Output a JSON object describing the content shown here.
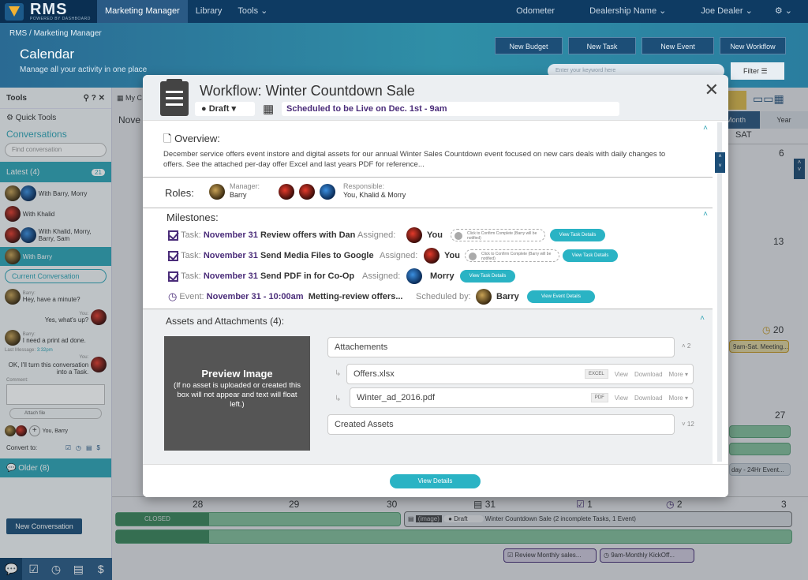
{
  "topbar": {
    "logo": "RMS",
    "logo_sub": "POWERED BY DASHBOARD",
    "tabs": [
      "Marketing Manager",
      "Library",
      "Tools"
    ],
    "odometer": "Odometer",
    "dealership": "Dealership Name",
    "user": "Joe Dealer"
  },
  "header": {
    "breadcrumb_root": "RMS",
    "breadcrumb_sep": "/",
    "breadcrumb_page": "Marketing Manager",
    "title": "Calendar",
    "subtitle": "Manage all your activity in one place",
    "buttons": [
      "New Budget",
      "New Task",
      "New Event",
      "New Workflow"
    ],
    "search_placeholder": "Enter your keyword here",
    "filter": "Filter"
  },
  "sidebar": {
    "tools": "Tools",
    "quick_tools": "Quick Tools",
    "conversations": "Conversations",
    "find_placeholder": "Find conversation",
    "latest": "Latest (4)",
    "latest_badge": "21",
    "threads": [
      "With Barry, Morry",
      "With Khalid",
      "With Khalid, Morry, Barry, Sam",
      "With Barry"
    ],
    "current_conv": "Current Conversation",
    "messages": [
      {
        "from": "Barry:",
        "text": "Hey, have a minute?"
      },
      {
        "from": "You:",
        "text": "Yes, what's up?"
      },
      {
        "from": "Barry:",
        "text": "I need a print ad done."
      },
      {
        "from": "You:",
        "text": "OK, I'll turn this conversation into a Task."
      }
    ],
    "last_message_label": "Last Message:",
    "last_message_time": "3:32pm",
    "comment_label": "Comment:",
    "attach": "Attach file",
    "participants": "You, Barry",
    "convert_to": "Convert to:",
    "older": "Older (8)",
    "new_conv": "New Conversation"
  },
  "calendar": {
    "toolbar_label": "My C",
    "month_label": "Nove",
    "views": [
      "Month",
      "Year"
    ],
    "sat": "SAT",
    "days": [
      "6",
      "13",
      "20",
      "27",
      "28",
      "29",
      "30",
      "31",
      "1",
      "2",
      "3"
    ],
    "events": {
      "e20": "9am-Sat. Meeting...",
      "e27": "day - 24Hr Event...",
      "closed": "CLOSED",
      "image": "(image)",
      "draft": "Draft",
      "workflow_bar": "Winter Countdown Sale (2 incomplete Tasks, 1 Event)",
      "review": "Review Monthly sales...",
      "kickoff": "9am-Monthly KickOff..."
    }
  },
  "modal": {
    "title": "Workflow: Winter Countdown Sale",
    "status": "Draft",
    "schedule_prefix": "Scheduled to be Live on",
    "schedule_date": "Dec. 1st - 9am",
    "overview_label": "Overview:",
    "overview_text": "December service offers event instore and digital assets for our annual Winter Sales Countdown event focused on new cars deals with daily changes to offers. See the attached per-day offer Excel and last years PDF for reference...",
    "roles_label": "Roles:",
    "manager_label": "Manager:",
    "manager_name": "Barry",
    "responsible_label": "Responsible:",
    "responsible_names": "You, Khalid & Morry",
    "milestones_label": "Milestones:",
    "milestones": [
      {
        "type": "Task:",
        "date": "November 31",
        "text": "Review offers with Dan",
        "assigned_label": "Assigned:",
        "assignee": "You",
        "confirm": "Click to Confirm Complete (Barry will be notified)",
        "button": "View Task Details"
      },
      {
        "type": "Task:",
        "date": "November 31",
        "text": "Send Media Files to Google",
        "assigned_label": "Assigned:",
        "assignee": "You",
        "confirm": "Click to Confirm Complete (Barry will be notified)",
        "button": "View Task Details"
      },
      {
        "type": "Task:",
        "date": "November 31",
        "text": "Send PDF in for Co-Op",
        "assigned_label": "Assigned:",
        "assignee": "Morry",
        "button": "View Task Details"
      },
      {
        "type": "Event:",
        "date": "November 31 - 10:00am",
        "text": "Metting-review offers...",
        "assigned_label": "Scheduled by:",
        "assignee": "Barry",
        "button": "View Event Details"
      }
    ],
    "assets_label": "Assets and Attachments (4):",
    "preview_title": "Preview Image",
    "preview_text": "(If no asset is uploaded or created this box will not appear and text will float left.)",
    "attachments_label": "Attachements",
    "attachments_count": "2",
    "files": [
      {
        "name": "Offers.xlsx",
        "tag": "EXCEL"
      },
      {
        "name": "Winter_ad_2016.pdf",
        "tag": "PDF"
      }
    ],
    "file_view": "View",
    "file_download": "Download",
    "file_more": "More",
    "created_label": "Created Assets",
    "created_count": "12",
    "view_details": "View Details"
  }
}
